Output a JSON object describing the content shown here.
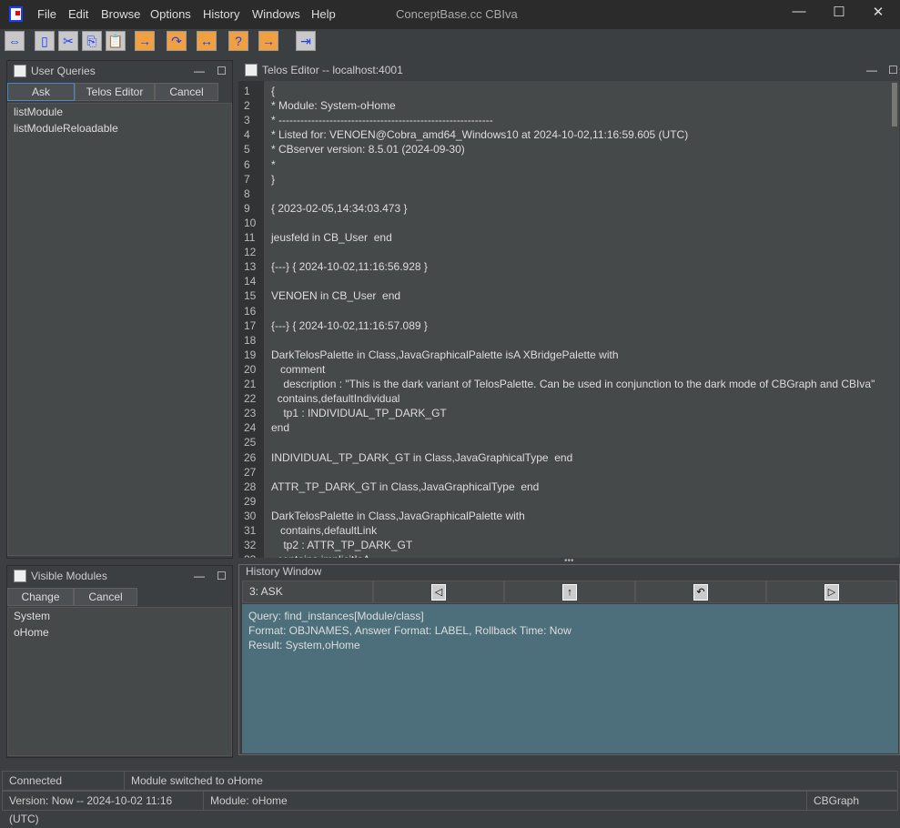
{
  "window": {
    "title": "ConceptBase.cc CBIva",
    "minimize": "—",
    "maximize": "☐",
    "close": "✕"
  },
  "menu": [
    "File",
    "Edit",
    "Browse",
    "Options",
    "History",
    "Windows",
    "Help"
  ],
  "toolbar": [
    {
      "icon": "connect-icon",
      "glyph": "⇔"
    },
    {
      "icon": "new-file-icon",
      "glyph": "▯"
    },
    {
      "icon": "cut-icon",
      "glyph": "✂"
    },
    {
      "icon": "copy-icon",
      "glyph": "⎘"
    },
    {
      "icon": "paste-icon",
      "glyph": "📋"
    },
    {
      "icon": "tell-icon",
      "glyph": "→"
    },
    {
      "icon": "untell-icon",
      "glyph": "↷"
    },
    {
      "icon": "retell-icon",
      "glyph": "↔"
    },
    {
      "icon": "ask-icon",
      "glyph": "?"
    },
    {
      "icon": "load-model-icon",
      "glyph": "→"
    },
    {
      "icon": "exit-icon",
      "glyph": "⇥"
    }
  ],
  "user_queries": {
    "title": "User Queries",
    "buttons": [
      "Ask",
      "Telos Editor",
      "Cancel"
    ],
    "items": [
      "listModule",
      "listModuleReloadable"
    ]
  },
  "visible_modules": {
    "title": "Visible Modules",
    "buttons": [
      "Change",
      "Cancel"
    ],
    "items": [
      "System",
      "oHome"
    ]
  },
  "editor": {
    "title": "Telos Editor -- localhost:4001",
    "lines": [
      "{",
      "* Module: System-oHome",
      "* -----------------------------------------------------------",
      "* Listed for: VENOEN@Cobra_amd64_Windows10 at 2024-10-02,11:16:59.605 (UTC)",
      "* CBserver version: 8.5.01 (2024-09-30)",
      "*",
      "}",
      "",
      "{ 2023-02-05,14:34:03.473 }",
      "",
      "jeusfeld in CB_User  end",
      "",
      "{---} { 2024-10-02,11:16:56.928 }",
      "",
      "VENOEN in CB_User  end",
      "",
      "{---} { 2024-10-02,11:16:57.089 }",
      "",
      "DarkTelosPalette in Class,JavaGraphicalPalette isA XBridgePalette with",
      "   comment",
      "    description : \"This is the dark variant of TelosPalette. Can be used in conjunction to the dark mode of CBGraph and CBIva\"",
      "  contains,defaultIndividual",
      "    tp1 : INDIVIDUAL_TP_DARK_GT",
      "end",
      "",
      "INDIVIDUAL_TP_DARK_GT in Class,JavaGraphicalType  end",
      "",
      "ATTR_TP_DARK_GT in Class,JavaGraphicalType  end",
      "",
      "DarkTelosPalette in Class,JavaGraphicalPalette with",
      "   contains,defaultLink",
      "    tp2 : ATTR_TP_DARK_GT",
      "  contains,implicitIsA"
    ]
  },
  "history": {
    "title": "History Window",
    "entry": "3:  ASK",
    "buttons": [
      {
        "icon": "back-icon",
        "glyph": "◁"
      },
      {
        "icon": "up-icon",
        "glyph": "↑"
      },
      {
        "icon": "undo-icon",
        "glyph": "↶"
      },
      {
        "icon": "forward-icon",
        "glyph": "▷"
      }
    ],
    "result": [
      "Query: find_instances[Module/class]",
      "Format: OBJNAMES, Answer Format: LABEL, Rollback Time: Now",
      "Result: System,oHome"
    ]
  },
  "status": {
    "connection": "Connected",
    "message": "Module switched to oHome",
    "version": "Version: Now -- 2024-10-02 11:16 (UTC)",
    "module": "Module: oHome",
    "app": "CBGraph"
  }
}
